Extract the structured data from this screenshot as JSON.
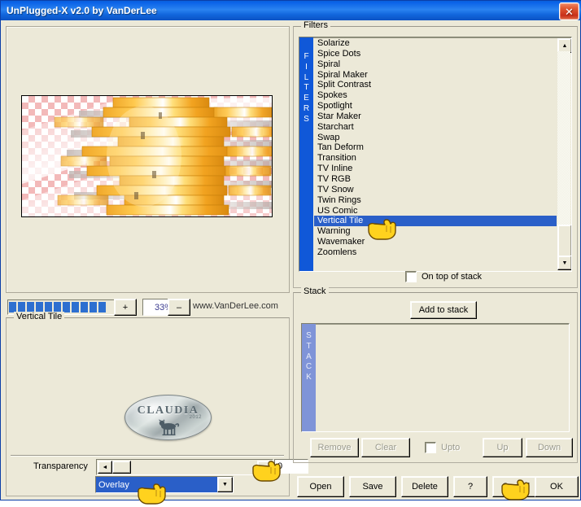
{
  "window": {
    "title": "UnPlugged-X v2.0 by VanDerLee",
    "close_label": "✕"
  },
  "preview": {
    "zoom_value": "33%",
    "zoom_in_label": "+",
    "zoom_out_label": "–",
    "website": "www.VanDerLee.com",
    "progress_blocks": 11
  },
  "vertical_tile": {
    "group_label": "Vertical Tile",
    "logo_text": "CLAUDIA",
    "logo_sub": "2012",
    "transparency_label": "Transparency",
    "transparency_value": "0",
    "slider_left_arrow": "◄",
    "slider_right_arrow": "►",
    "blend_mode": "Overlay",
    "combo_arrow": "▼"
  },
  "filters": {
    "group_label": "Filters",
    "strip_label": "FILTERS",
    "selected": "Vertical Tile",
    "items": [
      "Solarize",
      "Spice Dots",
      "Spiral",
      "Spiral Maker",
      "Split Contrast",
      "Spokes",
      "Spotlight",
      "Star Maker",
      "Starchart",
      "Swap",
      "Tan Deform",
      "Transition",
      "TV Inline",
      "TV RGB",
      "TV Snow",
      "Twin Rings",
      "US Comic",
      "Vertical Tile",
      "Warning",
      "Wavemaker",
      "Zoomlens"
    ],
    "scroll_up": "▲",
    "scroll_down": "▼",
    "on_top_label": "On top of stack",
    "on_top_checked": false
  },
  "stack": {
    "group_label": "Stack",
    "strip_label": "STACK",
    "add_label": "Add to stack",
    "items": [],
    "remove_label": "Remove",
    "clear_label": "Clear",
    "upto_label": "Upto",
    "upto_checked": false,
    "up_label": "Up",
    "down_label": "Down"
  },
  "footer": {
    "open_label": "Open",
    "save_label": "Save",
    "delete_label": "Delete",
    "help_label": "?",
    "cancel_label": "Cancel",
    "ok_label": "OK"
  },
  "colors": {
    "title_blue": "#0a62e8",
    "face": "#ece9d8",
    "selection_blue": "#2a5fc8",
    "strip_blue": "#1058d8",
    "strip_blue_disabled": "#7f94d8",
    "close_red": "#c8301a",
    "progress_blue": "#2d6fd0"
  }
}
